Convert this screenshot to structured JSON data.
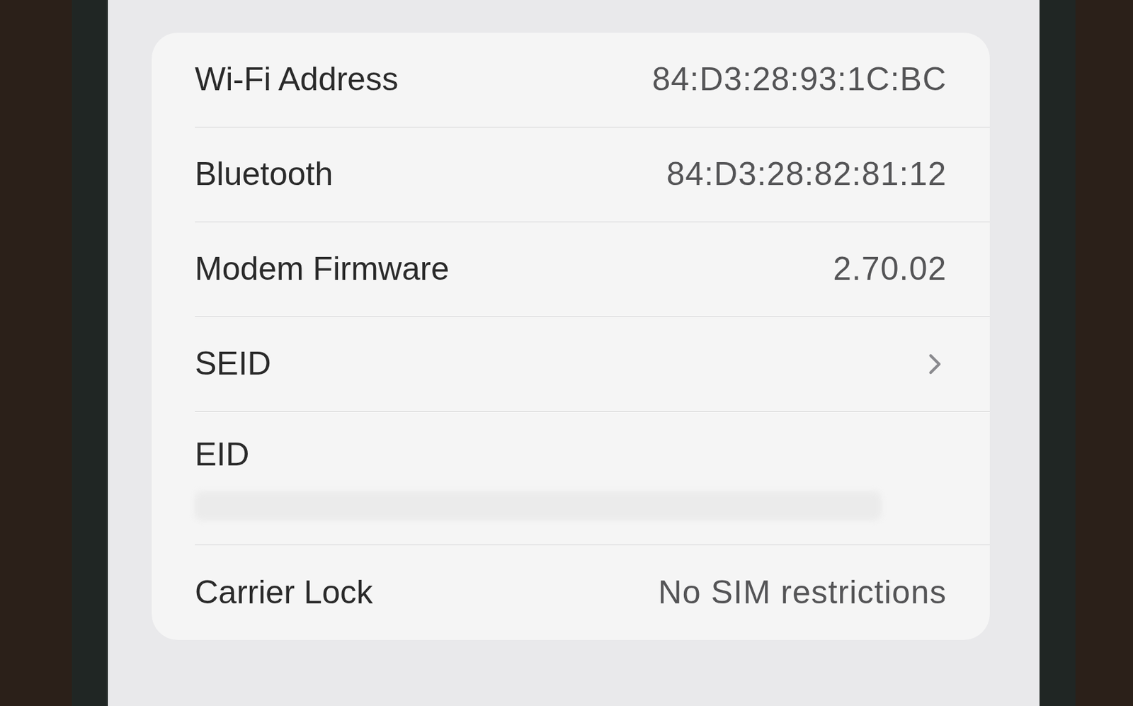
{
  "rows": [
    {
      "label": "Wi-Fi Address",
      "value": "84:D3:28:93:1C:BC",
      "kind": "value"
    },
    {
      "label": "Bluetooth",
      "value": "84:D3:28:82:81:12",
      "kind": "value"
    },
    {
      "label": "Modem Firmware",
      "value": "2.70.02",
      "kind": "value"
    },
    {
      "label": "SEID",
      "value": "",
      "kind": "link"
    },
    {
      "label": "EID",
      "value": "",
      "kind": "hidden"
    },
    {
      "label": "Carrier Lock",
      "value": "No SIM restrictions",
      "kind": "value"
    }
  ]
}
